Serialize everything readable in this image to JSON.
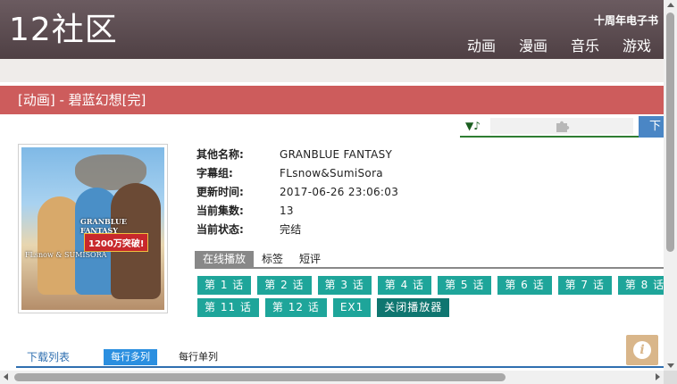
{
  "header": {
    "logo": "12社区",
    "anniversary": "十周年电子书",
    "nav": [
      "动画",
      "漫画",
      "音乐",
      "游戏"
    ]
  },
  "title": "[动画] - 碧蓝幻想[完]",
  "player": {
    "music_icon": "▼♪",
    "plugin_icon": "puzzle-icon",
    "download_label": "下"
  },
  "cover": {
    "logo_text": "GRANBLUE FANTASY",
    "badge_text": "1200万突破!",
    "group_text": "FLsnow & SUMISORA"
  },
  "info": [
    {
      "key": "其他名称:",
      "value": "GRANBLUE FANTASY"
    },
    {
      "key": "字幕组:",
      "value": "FLsnow&SumiSora"
    },
    {
      "key": "更新时间:",
      "value": "2017-06-26 23:06:03"
    },
    {
      "key": "当前集数:",
      "value": "13"
    },
    {
      "key": "当前状态:",
      "value": "完结"
    }
  ],
  "tabs": [
    "在线播放",
    "标签",
    "短评"
  ],
  "episodes_row1": [
    "第 1 话",
    "第 2 话",
    "第 3 话",
    "第 4 话",
    "第 5 话",
    "第 6 话",
    "第 7 话",
    "第 8 话"
  ],
  "episodes_row2": [
    "第 11 话",
    "第 12 话",
    "EX1",
    "关闭播放器"
  ],
  "download": {
    "label": "下载列表",
    "tab_multi": "每行多列",
    "tab_single": "每行单列"
  },
  "info_button": "i",
  "colors": {
    "header": "#5c4c51",
    "title_bar": "#cd5c5c",
    "episode": "#1ea59a",
    "close_player": "#0f7670",
    "link": "#2f6fb0"
  }
}
